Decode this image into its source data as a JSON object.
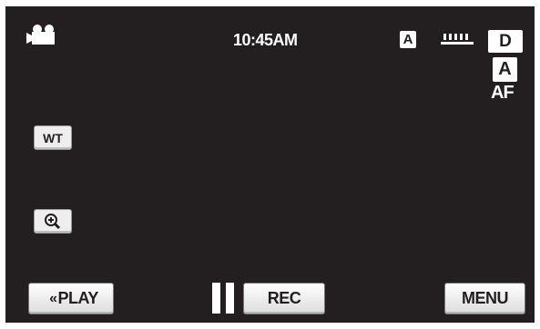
{
  "status_bar": {
    "mode_icon": "video-camera-icon",
    "time": "10:45AM",
    "auto_badge": "A",
    "battery_icon": "battery-icon"
  },
  "right_panel": {
    "d_badge": "D",
    "a_badge": "A",
    "af_label": "AF"
  },
  "left_panel": {
    "wt_label": "WT",
    "zoom_icon": "zoom-icon"
  },
  "bottom_bar": {
    "play_label": "PLAY",
    "pause_icon": "pause-icon",
    "rec_label": "REC",
    "menu_label": "MENU"
  }
}
